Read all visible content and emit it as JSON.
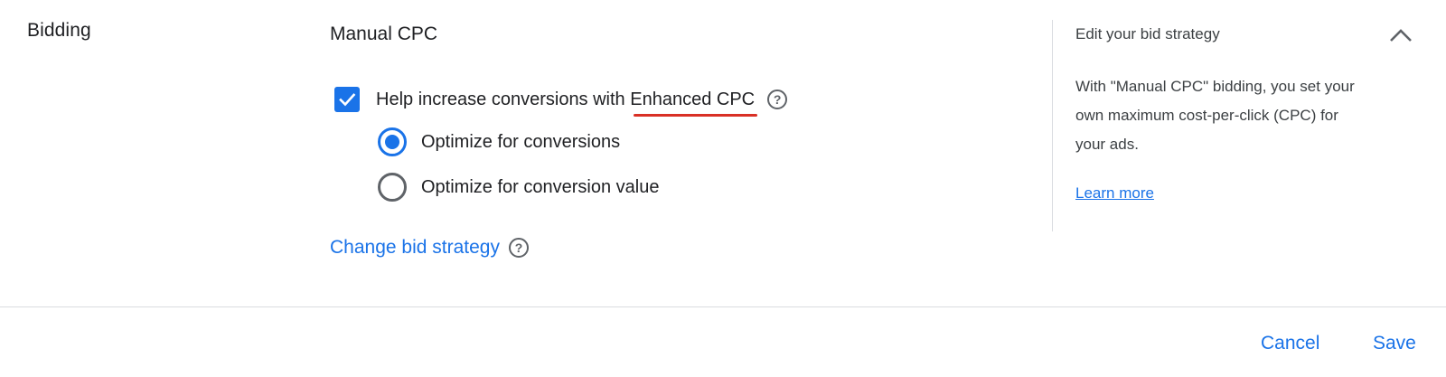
{
  "section": {
    "title": "Bidding"
  },
  "strategy": {
    "name": "Manual CPC"
  },
  "enhanced": {
    "label_prefix": "Help increase conversions with ",
    "label_highlight": "Enhanced CPC",
    "checked": true,
    "help_glyph": "?"
  },
  "radios": [
    {
      "label": "Optimize for conversions",
      "selected": true
    },
    {
      "label": "Optimize for conversion value",
      "selected": false
    }
  ],
  "change_link": {
    "label": "Change bid strategy",
    "help_glyph": "?"
  },
  "panel": {
    "title": "Edit your bid strategy",
    "body": "With \"Manual CPC\" bidding, you set your own maximum cost-per-click (CPC) for your ads.",
    "learn_more": "Learn more",
    "collapse_icon": "chevron-up-icon"
  },
  "footer": {
    "cancel_label": "Cancel",
    "save_label": "Save"
  },
  "colors": {
    "accent": "#1a73e8",
    "underline": "#d93025",
    "divider": "#dadce0"
  }
}
